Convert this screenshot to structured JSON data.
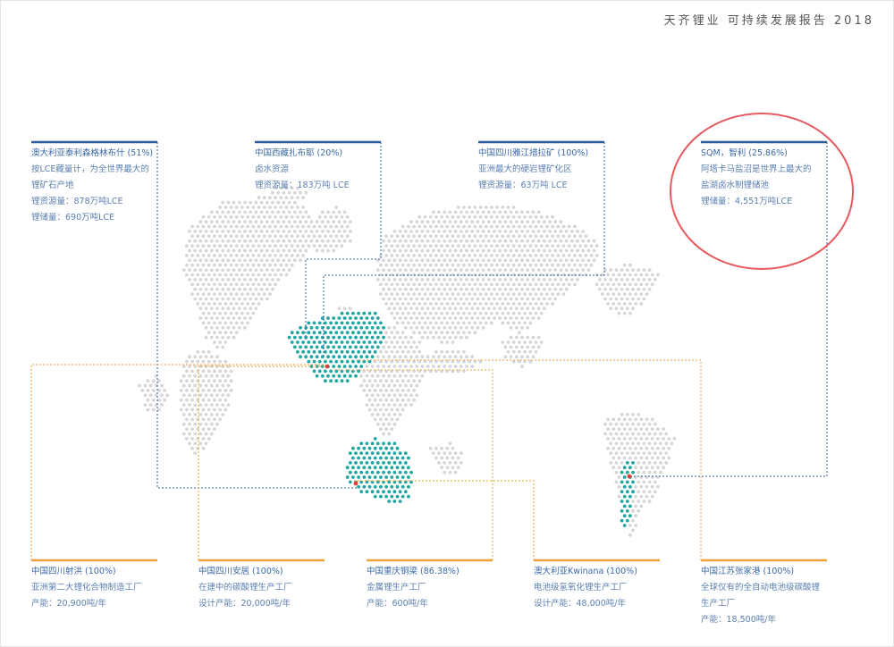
{
  "header": {
    "title": "天齐锂业  可持续发展报告  2018"
  },
  "colors": {
    "top_accent": "#2e5c9a",
    "bottom_accent": "#f0a23a",
    "teal_dot": "#1fa6a1",
    "grey_dot": "#d6d6d6",
    "highlight_ring": "#e8595d"
  },
  "top_cards": [
    {
      "title": "澳大利亚泰利森格林布什 (51%)",
      "lines": [
        "按LCE藏量计，为全世界最大的",
        "锂矿石产地",
        "锂资源量：878万吨LCE",
        "锂储量：690万吨LCE"
      ]
    },
    {
      "title": "中国西藏扎布耶 (20%)",
      "lines": [
        "卤水资源",
        "锂资源量：183万吨 LCE"
      ]
    },
    {
      "title": "中国四川雅江措拉矿 (100%)",
      "lines": [
        "亚洲最大的硬岩锂矿化区",
        "锂资源量：63万吨 LCE"
      ]
    },
    {
      "title": "SQM，智利 (25.86%)",
      "lines": [
        "阿塔卡马盐沼是世界上最大的",
        "盐湖卤水制锂储池",
        "锂储量：4,551万吨LCE"
      ]
    }
  ],
  "bottom_cards": [
    {
      "title": "中国四川射洪 (100%)",
      "lines": [
        "亚洲第二大锂化合物制造工厂",
        "产能：20,900吨/年"
      ]
    },
    {
      "title": "中国四川安居 (100%)",
      "lines": [
        "在建中的碳酸锂生产工厂",
        "设计产能：20,000吨/年"
      ]
    },
    {
      "title": "中国重庆铜梁 (86.38%)",
      "lines": [
        "金属锂生产工厂",
        "产能：600吨/年"
      ]
    },
    {
      "title": "澳大利亚Kwinana (100%)",
      "lines": [
        "电池级氢氧化锂生产工厂",
        "设计产能：48,000吨/年"
      ]
    },
    {
      "title": "中国江苏张家港 (100%)",
      "lines": [
        "全球仅有的全自动电池级碳酸锂",
        "生产工厂",
        "产能：18,500吨/年"
      ]
    }
  ]
}
